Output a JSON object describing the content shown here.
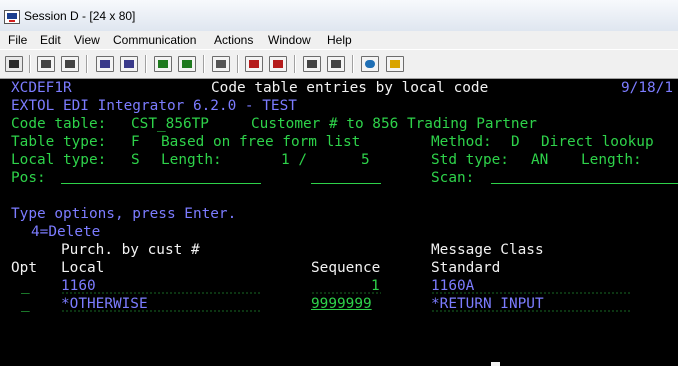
{
  "window": {
    "title": "Session D - [24 x 80]",
    "icon": "session-app-icon"
  },
  "menu": [
    {
      "label": "File"
    },
    {
      "label": "Edit"
    },
    {
      "label": "View"
    },
    {
      "label": "Communication"
    },
    {
      "label": "Actions"
    },
    {
      "label": "Window"
    },
    {
      "label": "Help"
    }
  ],
  "toolbar": {
    "buttons": [
      {
        "name": "print-screen-icon",
        "color": "#2a2a2a"
      },
      {
        "name": "copy-icon",
        "color": "#444444"
      },
      {
        "name": "paste-icon",
        "color": "#444444"
      },
      {
        "name": "send-file-icon",
        "color": "#3a3a8a"
      },
      {
        "name": "receive-file-icon",
        "color": "#3a3a8a"
      },
      {
        "name": "display-keypad-icon",
        "color": "#1f7a1f"
      },
      {
        "name": "customize-keyboard-icon",
        "color": "#1f7a1f"
      },
      {
        "name": "macro-icon",
        "color": "#555555"
      },
      {
        "name": "record-macro-icon",
        "color": "#b51b1b"
      },
      {
        "name": "stop-macro-icon",
        "color": "#b51b1b"
      },
      {
        "name": "play-macro-icon",
        "color": "#444444"
      },
      {
        "name": "run-macro-icon",
        "color": "#444444"
      },
      {
        "name": "connect-globe-icon",
        "color": "#1f6fb5"
      },
      {
        "name": "disconnect-icon",
        "color": "#d9a400"
      }
    ]
  },
  "screen": {
    "program": "XCDEF1R",
    "title": "Code table entries by local code",
    "date": "9/18/1",
    "product": "EXTOL EDI Integrator 6.2.0 - TEST",
    "code_table_label": "Code table:",
    "code_table_value": "CST_856TP",
    "code_table_desc": "Customer # to 856 Trading Partner",
    "table_type_label": "Table type:",
    "table_type_value": "F",
    "table_type_desc": "Based on free form list",
    "method_label": "Method:",
    "method_value": "D",
    "method_desc": "Direct lookup",
    "local_type_label": "Local type:",
    "local_type_value": "S",
    "length_label": "Length:",
    "length_value": "1 /",
    "length_value2": "5",
    "std_type_label": "Std type:",
    "std_type_value": "AN",
    "std_length_label": "Length:",
    "pos_label": "Pos:",
    "scan_label": "Scan:",
    "instructions": "Type options, press Enter.",
    "option_hint": "4=Delete",
    "col_purch_header": "Purch. by cust #",
    "col_msgclass_header": "Message Class",
    "col_opt_header": "Opt",
    "col_local_header": "Local",
    "col_sequence_header": "Sequence",
    "col_standard_header": "Standard",
    "rows": [
      {
        "opt": "_",
        "local": "1160",
        "sequence": "1",
        "standard": "1160A"
      },
      {
        "opt": "_",
        "local": "*OTHERWISE",
        "sequence": "9999999",
        "standard": "*RETURN INPUT"
      }
    ]
  }
}
